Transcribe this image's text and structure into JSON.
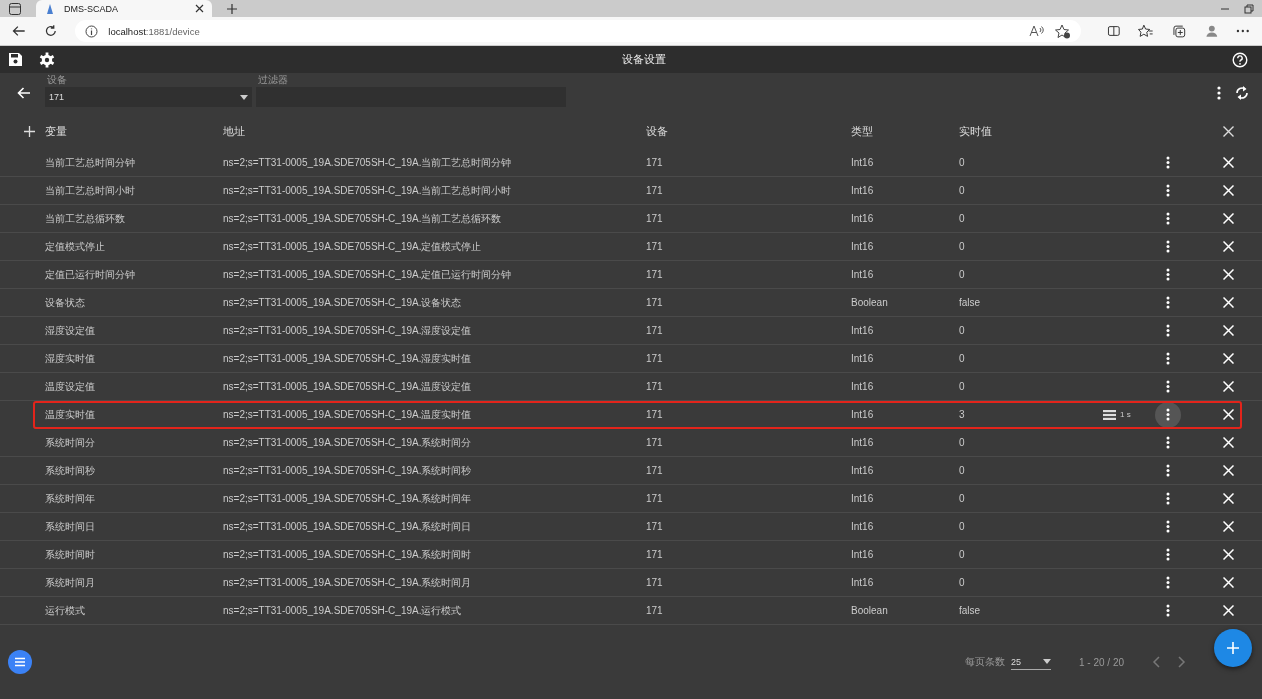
{
  "browser": {
    "tab_title": "DMS-SCADA",
    "url_host": "localhost",
    "url_path": ":1881/device"
  },
  "header": {
    "title": "设备设置"
  },
  "toolbar": {
    "device_label": "设备",
    "device_value": "171",
    "filter_label": "过滤器"
  },
  "table": {
    "columns": [
      "变量",
      "地址",
      "设备",
      "类型",
      "实时值"
    ],
    "rows": [
      {
        "name": "当前工艺总时间分钟",
        "address": "ns=2;s=TT31-0005_19A.SDE705SH-C_19A.当前工艺总时间分钟",
        "device": "171",
        "type": "Int16",
        "value": "0",
        "selected": false
      },
      {
        "name": "当前工艺总时间小时",
        "address": "ns=2;s=TT31-0005_19A.SDE705SH-C_19A.当前工艺总时间小时",
        "device": "171",
        "type": "Int16",
        "value": "0",
        "selected": false
      },
      {
        "name": "当前工艺总循环数",
        "address": "ns=2;s=TT31-0005_19A.SDE705SH-C_19A.当前工艺总循环数",
        "device": "171",
        "type": "Int16",
        "value": "0",
        "selected": false
      },
      {
        "name": "定值模式停止",
        "address": "ns=2;s=TT31-0005_19A.SDE705SH-C_19A.定值模式停止",
        "device": "171",
        "type": "Int16",
        "value": "0",
        "selected": false
      },
      {
        "name": "定值已运行时间分钟",
        "address": "ns=2;s=TT31-0005_19A.SDE705SH-C_19A.定值已运行时间分钟",
        "device": "171",
        "type": "Int16",
        "value": "0",
        "selected": false
      },
      {
        "name": "设备状态",
        "address": "ns=2;s=TT31-0005_19A.SDE705SH-C_19A.设备状态",
        "device": "171",
        "type": "Boolean",
        "value": "false",
        "selected": false
      },
      {
        "name": "湿度设定值",
        "address": "ns=2;s=TT31-0005_19A.SDE705SH-C_19A.湿度设定值",
        "device": "171",
        "type": "Int16",
        "value": "0",
        "selected": false
      },
      {
        "name": "湿度实时值",
        "address": "ns=2;s=TT31-0005_19A.SDE705SH-C_19A.湿度实时值",
        "device": "171",
        "type": "Int16",
        "value": "0",
        "selected": false
      },
      {
        "name": "温度设定值",
        "address": "ns=2;s=TT31-0005_19A.SDE705SH-C_19A.温度设定值",
        "device": "171",
        "type": "Int16",
        "value": "0",
        "selected": false
      },
      {
        "name": "温度实时值",
        "address": "ns=2;s=TT31-0005_19A.SDE705SH-C_19A.温度实时值",
        "device": "171",
        "type": "Int16",
        "value": "3",
        "interval": "1 s",
        "selected": true
      },
      {
        "name": "系统时间分",
        "address": "ns=2;s=TT31-0005_19A.SDE705SH-C_19A.系统时间分",
        "device": "171",
        "type": "Int16",
        "value": "0",
        "selected": false
      },
      {
        "name": "系统时间秒",
        "address": "ns=2;s=TT31-0005_19A.SDE705SH-C_19A.系统时间秒",
        "device": "171",
        "type": "Int16",
        "value": "0",
        "selected": false
      },
      {
        "name": "系统时间年",
        "address": "ns=2;s=TT31-0005_19A.SDE705SH-C_19A.系统时间年",
        "device": "171",
        "type": "Int16",
        "value": "0",
        "selected": false
      },
      {
        "name": "系统时间日",
        "address": "ns=2;s=TT31-0005_19A.SDE705SH-C_19A.系统时间日",
        "device": "171",
        "type": "Int16",
        "value": "0",
        "selected": false
      },
      {
        "name": "系统时间时",
        "address": "ns=2;s=TT31-0005_19A.SDE705SH-C_19A.系统时间时",
        "device": "171",
        "type": "Int16",
        "value": "0",
        "selected": false
      },
      {
        "name": "系统时间月",
        "address": "ns=2;s=TT31-0005_19A.SDE705SH-C_19A.系统时间月",
        "device": "171",
        "type": "Int16",
        "value": "0",
        "selected": false
      },
      {
        "name": "运行模式",
        "address": "ns=2;s=TT31-0005_19A.SDE705SH-C_19A.运行模式",
        "device": "171",
        "type": "Boolean",
        "value": "false",
        "selected": false
      }
    ]
  },
  "paginator": {
    "page_size_label": "每页条数",
    "page_size": "25",
    "range": "1 - 20 / 20"
  }
}
